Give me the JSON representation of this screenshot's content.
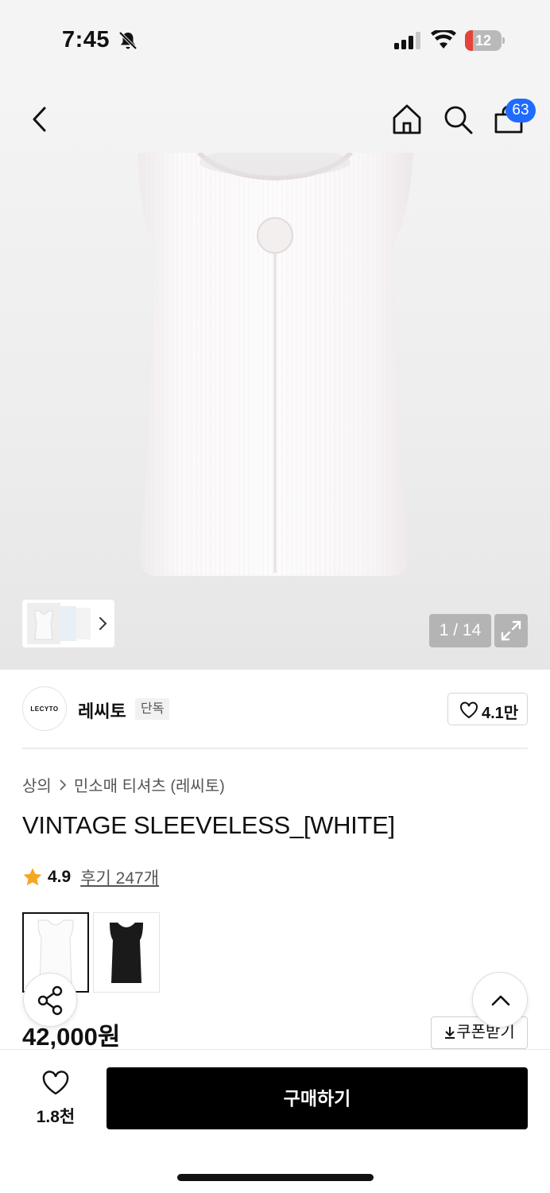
{
  "status_bar": {
    "time": "7:45",
    "battery_level": "12",
    "icons": [
      "bell-muted-icon",
      "signal-icon",
      "wifi-icon",
      "battery-icon"
    ]
  },
  "nav": {
    "icons": [
      "back-icon",
      "home-icon",
      "search-icon",
      "cart-icon"
    ],
    "cart_count": "63"
  },
  "gallery": {
    "counter": "1 / 14",
    "icons": [
      "chevron-right-icon",
      "expand-icon"
    ]
  },
  "brand": {
    "logo_text": "LECYTO",
    "name": "레씨토",
    "tag": "단독",
    "likes": "4.1만"
  },
  "product": {
    "breadcrumb": [
      "상의",
      "민소매 티셔츠 (레씨토)"
    ],
    "title": "VINTAGE SLEEVELESS_[WHITE]",
    "rating": "4.9",
    "reviews": "후기 247개",
    "price": "42,000원",
    "coupon_label": "쿠폰받기"
  },
  "bottom_bar": {
    "wish_count": "1.8천",
    "buy_label": "구매하기"
  },
  "colors": {
    "accent_blue": "#1f6bff",
    "star": "#f5a623",
    "buy_button": "#000000"
  }
}
